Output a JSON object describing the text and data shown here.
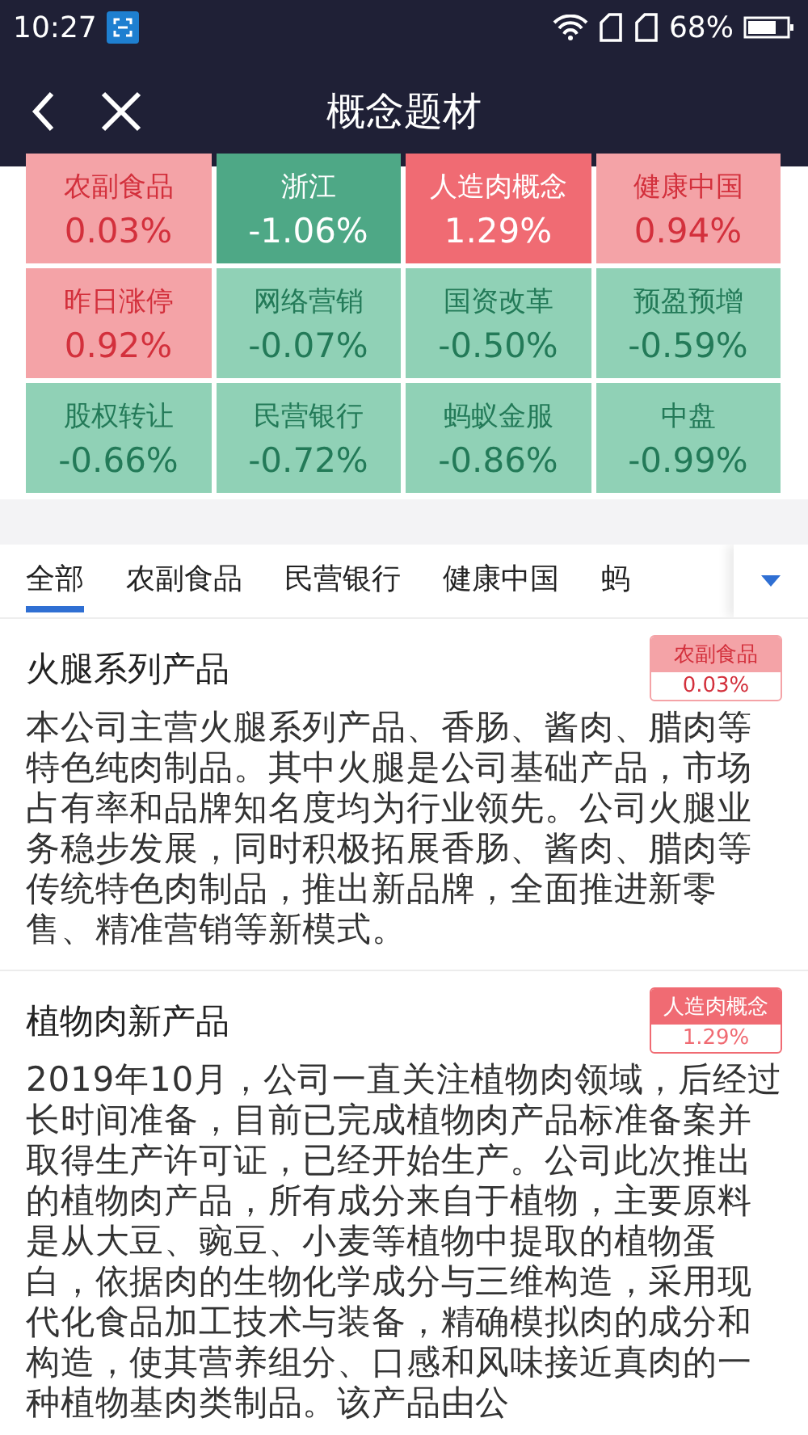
{
  "status_bar": {
    "time": "10:27",
    "battery_text": "68%"
  },
  "header": {
    "title": "概念题材"
  },
  "concepts": [
    {
      "name": "农副食品",
      "change": "0.03%",
      "kind": "up_weak"
    },
    {
      "name": "浙江",
      "change": "-1.06%",
      "kind": "down_strong"
    },
    {
      "name": "人造肉概念",
      "change": "1.29%",
      "kind": "up_strong"
    },
    {
      "name": "健康中国",
      "change": "0.94%",
      "kind": "up_weak"
    },
    {
      "name": "昨日涨停",
      "change": "0.92%",
      "kind": "up_weak"
    },
    {
      "name": "网络营销",
      "change": "-0.07%",
      "kind": "down_weak"
    },
    {
      "name": "国资改革",
      "change": "-0.50%",
      "kind": "down_weak"
    },
    {
      "name": "预盈预增",
      "change": "-0.59%",
      "kind": "down_weak"
    },
    {
      "name": "股权转让",
      "change": "-0.66%",
      "kind": "down_weak"
    },
    {
      "name": "民营银行",
      "change": "-0.72%",
      "kind": "down_weak"
    },
    {
      "name": "蚂蚁金服",
      "change": "-0.86%",
      "kind": "down_weak"
    },
    {
      "name": "中盘",
      "change": "-0.99%",
      "kind": "down_weak"
    }
  ],
  "tabs": [
    {
      "label": "全部",
      "selected": true
    },
    {
      "label": "农副食品",
      "selected": false
    },
    {
      "label": "民营银行",
      "selected": false
    },
    {
      "label": "健康中国",
      "selected": false
    },
    {
      "label": "蚂",
      "selected": false
    }
  ],
  "articles": [
    {
      "title": "火腿系列产品",
      "tag": {
        "name": "农副食品",
        "change": "0.03%",
        "kind": "up_weak"
      },
      "body": "本公司主营火腿系列产品、香肠、酱肉、腊肉等特色纯肉制品。其中火腿是公司基础产品，市场占有率和品牌知名度均为行业领先。公司火腿业务稳步发展，同时积极拓展香肠、酱肉、腊肉等传统特色肉制品，推出新品牌，全面推进新零售、精准营销等新模式。"
    },
    {
      "title": "植物肉新产品",
      "tag": {
        "name": "人造肉概念",
        "change": "1.29%",
        "kind": "up_strong"
      },
      "body": "2019年10月，公司一直关注植物肉领域，后经过长时间准备，目前已完成植物肉产品标准备案并取得生产许可证，已经开始生产。公司此次推出的植物肉产品，所有成分来自于植物，主要原料是从大豆、豌豆、小麦等植物中提取的植物蛋白，依据肉的生物化学成分与三维构造，采用现代化食品加工技术与装备，精确模拟肉的成分和构造，使其营养组分、口感和风味接近真肉的一种植物基肉类制品。该产品由公"
    }
  ]
}
